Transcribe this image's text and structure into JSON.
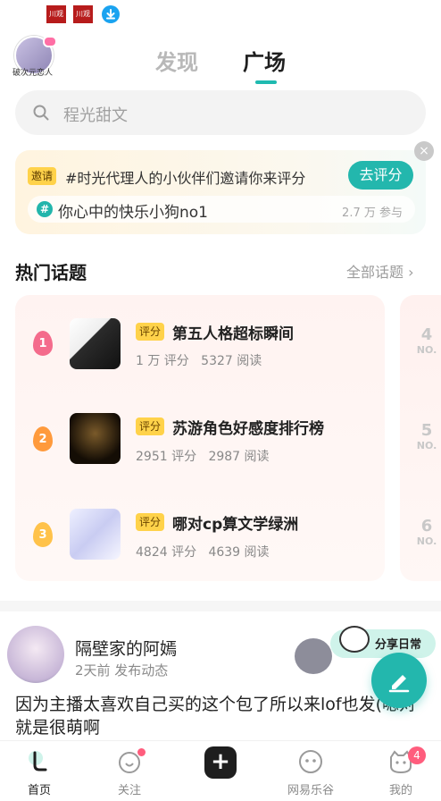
{
  "status_bar": {
    "app_icon_1": "川观",
    "app_icon_2": "川观",
    "download_icon": "download-icon"
  },
  "header": {
    "avatar_caption": "破次元恋人",
    "tabs": [
      {
        "label": "发现",
        "active": false
      },
      {
        "label": "广场",
        "active": true
      }
    ]
  },
  "search": {
    "placeholder": "程光甜文"
  },
  "invite_card": {
    "tag": "邀请",
    "text": "#时光代理人的小伙伴们邀请你来评分",
    "button": "去评分",
    "close": "×",
    "topic": {
      "icon": "#",
      "title": "你心中的快乐小狗no1",
      "count": "2.7 万 参与"
    }
  },
  "hot_topics": {
    "title": "热门话题",
    "all_link": "全部话题 ›",
    "items": [
      {
        "rank": "1",
        "badge": "评分",
        "title": "第五人格超标瞬间",
        "ratings": "1 万 评分",
        "reads": "5327 阅读"
      },
      {
        "rank": "2",
        "badge": "评分",
        "title": "苏游角色好感度排行榜",
        "ratings": "2951 评分",
        "reads": "2987 阅读"
      },
      {
        "rank": "3",
        "badge": "评分",
        "title": "哪对cp算文学绿洲",
        "ratings": "4824 评分",
        "reads": "4639 阅读"
      }
    ],
    "next_column": [
      {
        "num": "4",
        "label": "NO."
      },
      {
        "num": "5",
        "label": "NO."
      },
      {
        "num": "6",
        "label": "NO."
      }
    ]
  },
  "feed_post": {
    "author": "隔壁家的阿嫣",
    "meta": "2天前 发布动态",
    "share_label": "分享日常",
    "body": "因为主播太喜欢自己买的这个包了所以来lof也发(嗯对就是很萌啊"
  },
  "bottom_nav": {
    "items": [
      {
        "label": "首页",
        "active": true
      },
      {
        "label": "关注",
        "active": false
      },
      {
        "label": "",
        "active": false
      },
      {
        "label": "网易乐谷",
        "active": false
      },
      {
        "label": "我的",
        "active": false,
        "badge": "4"
      }
    ]
  },
  "colors": {
    "accent": "#23b7ad",
    "badge": "#ffd24a",
    "rank1": "#f46b8c",
    "rank2": "#ff9a3c",
    "rank3": "#ffc24a",
    "notification": "#ff5d7d"
  }
}
